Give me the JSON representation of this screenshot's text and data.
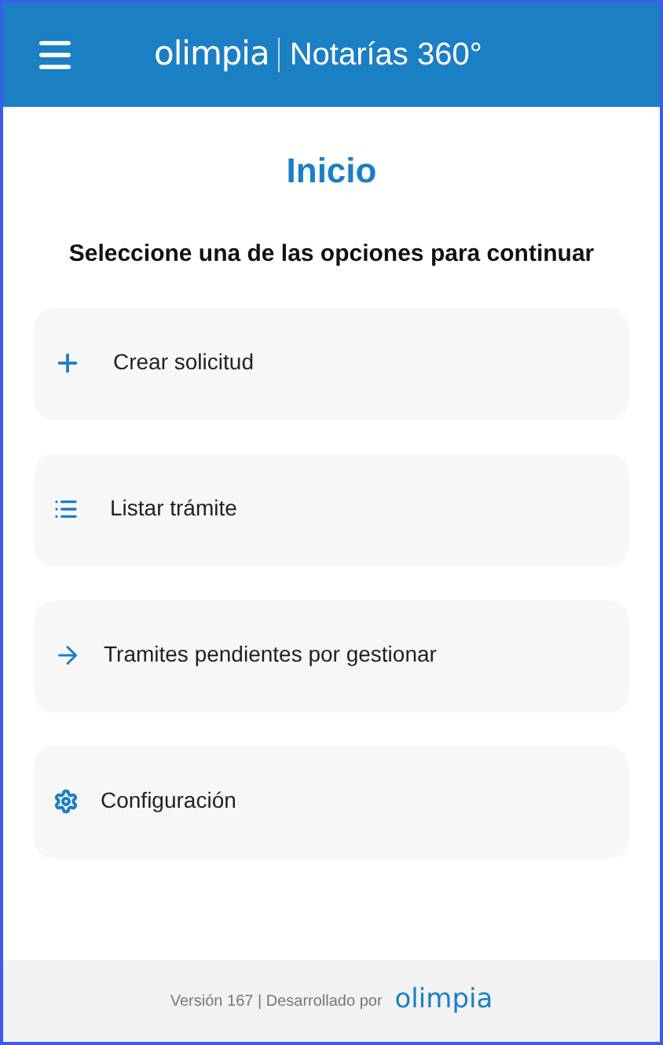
{
  "header": {
    "logo": "olimpia",
    "product": "Notarías 360°"
  },
  "title": "Inicio",
  "subtitle": "Seleccione una de las opciones para continuar",
  "options": [
    {
      "kind": "plus",
      "label": "Crear solicitud"
    },
    {
      "kind": "list",
      "label": "Listar trámite"
    },
    {
      "kind": "arrow",
      "label": "Tramites pendientes por gestionar"
    },
    {
      "kind": "gear",
      "label": "Configuración"
    }
  ],
  "footer": {
    "text": "Versión 167 | Desarrollado por",
    "logo": "olimpia"
  }
}
